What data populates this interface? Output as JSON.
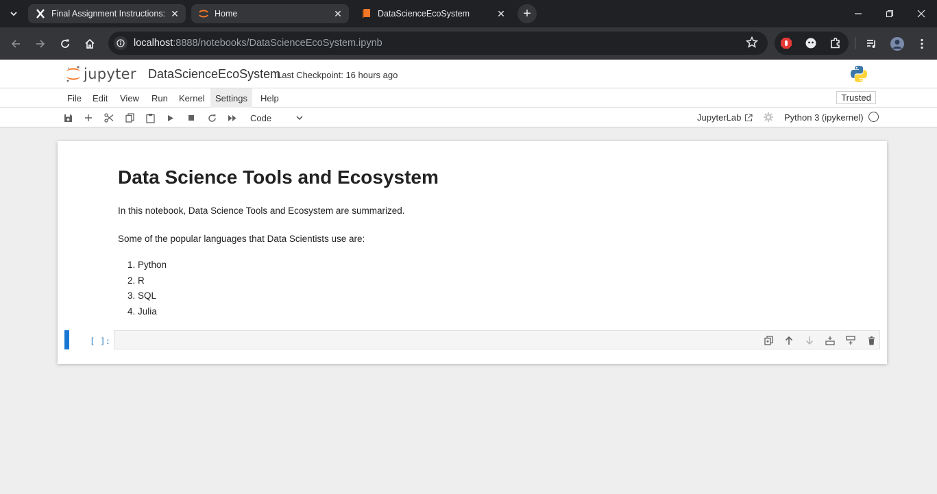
{
  "browser": {
    "tabs": [
      {
        "title": "Final Assignment Instructions: C",
        "icon": "x-favicon"
      },
      {
        "title": "Home",
        "icon": "jupyter-favicon"
      },
      {
        "title": "DataScienceEcoSystem",
        "icon": "notebook-favicon"
      }
    ],
    "url": {
      "host": "localhost",
      "path": ":8888/notebooks/DataScienceEcoSystem.ipynb"
    }
  },
  "header": {
    "logo_text": "jupyter",
    "notebook_name": "DataScienceEcoSystem",
    "checkpoint": "Last Checkpoint: 16 hours ago"
  },
  "menu": {
    "items": [
      "File",
      "Edit",
      "View",
      "Run",
      "Kernel",
      "Settings",
      "Help"
    ],
    "trusted": "Trusted"
  },
  "toolbar": {
    "cell_type": "Code",
    "jupyterlab_label": "JupyterLab",
    "kernel_name": "Python 3 (ipykernel)"
  },
  "notebook": {
    "heading": "Data Science Tools and Ecosystem",
    "intro": "In this notebook, Data Science Tools and Ecosystem are summarized.",
    "languages_intro": "Some of the popular languages that Data Scientists use are:",
    "languages": [
      "1. Python",
      "2. R",
      "3. SQL",
      "4. Julia"
    ],
    "code_prompt": "[ ]:"
  },
  "colors": {
    "accent": "#1976d2",
    "prompt": "#307fc1",
    "jupyter_orange": "#f37726"
  }
}
